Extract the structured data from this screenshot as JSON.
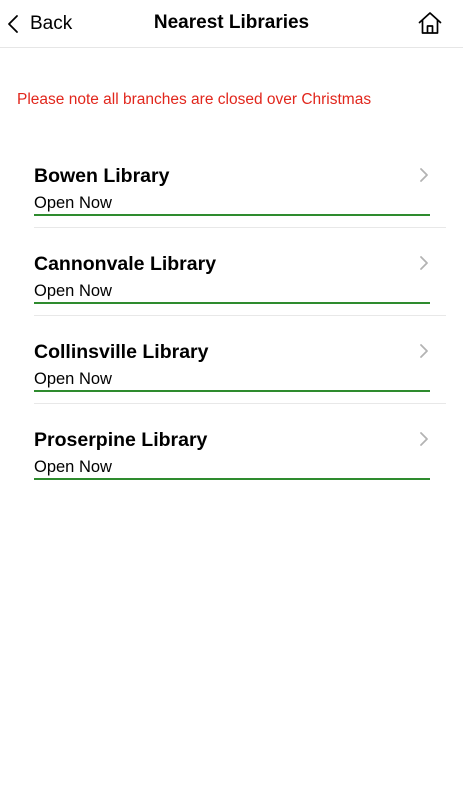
{
  "header": {
    "back_label": "Back",
    "title": "Nearest Libraries",
    "back_icon": "chevron-left-icon",
    "home_icon": "home-icon"
  },
  "notice": {
    "text": "Please note all branches are closed over Christmas",
    "color": "#e1261c"
  },
  "libraries": [
    {
      "name": "Bowen Library",
      "status": "Open Now"
    },
    {
      "name": "Cannonvale Library",
      "status": "Open Now"
    },
    {
      "name": "Collinsville Library",
      "status": "Open Now"
    },
    {
      "name": "Proserpine Library",
      "status": "Open Now"
    }
  ],
  "colors": {
    "open_status": "#2e8b2e",
    "chevron": "#b3b3b3"
  }
}
